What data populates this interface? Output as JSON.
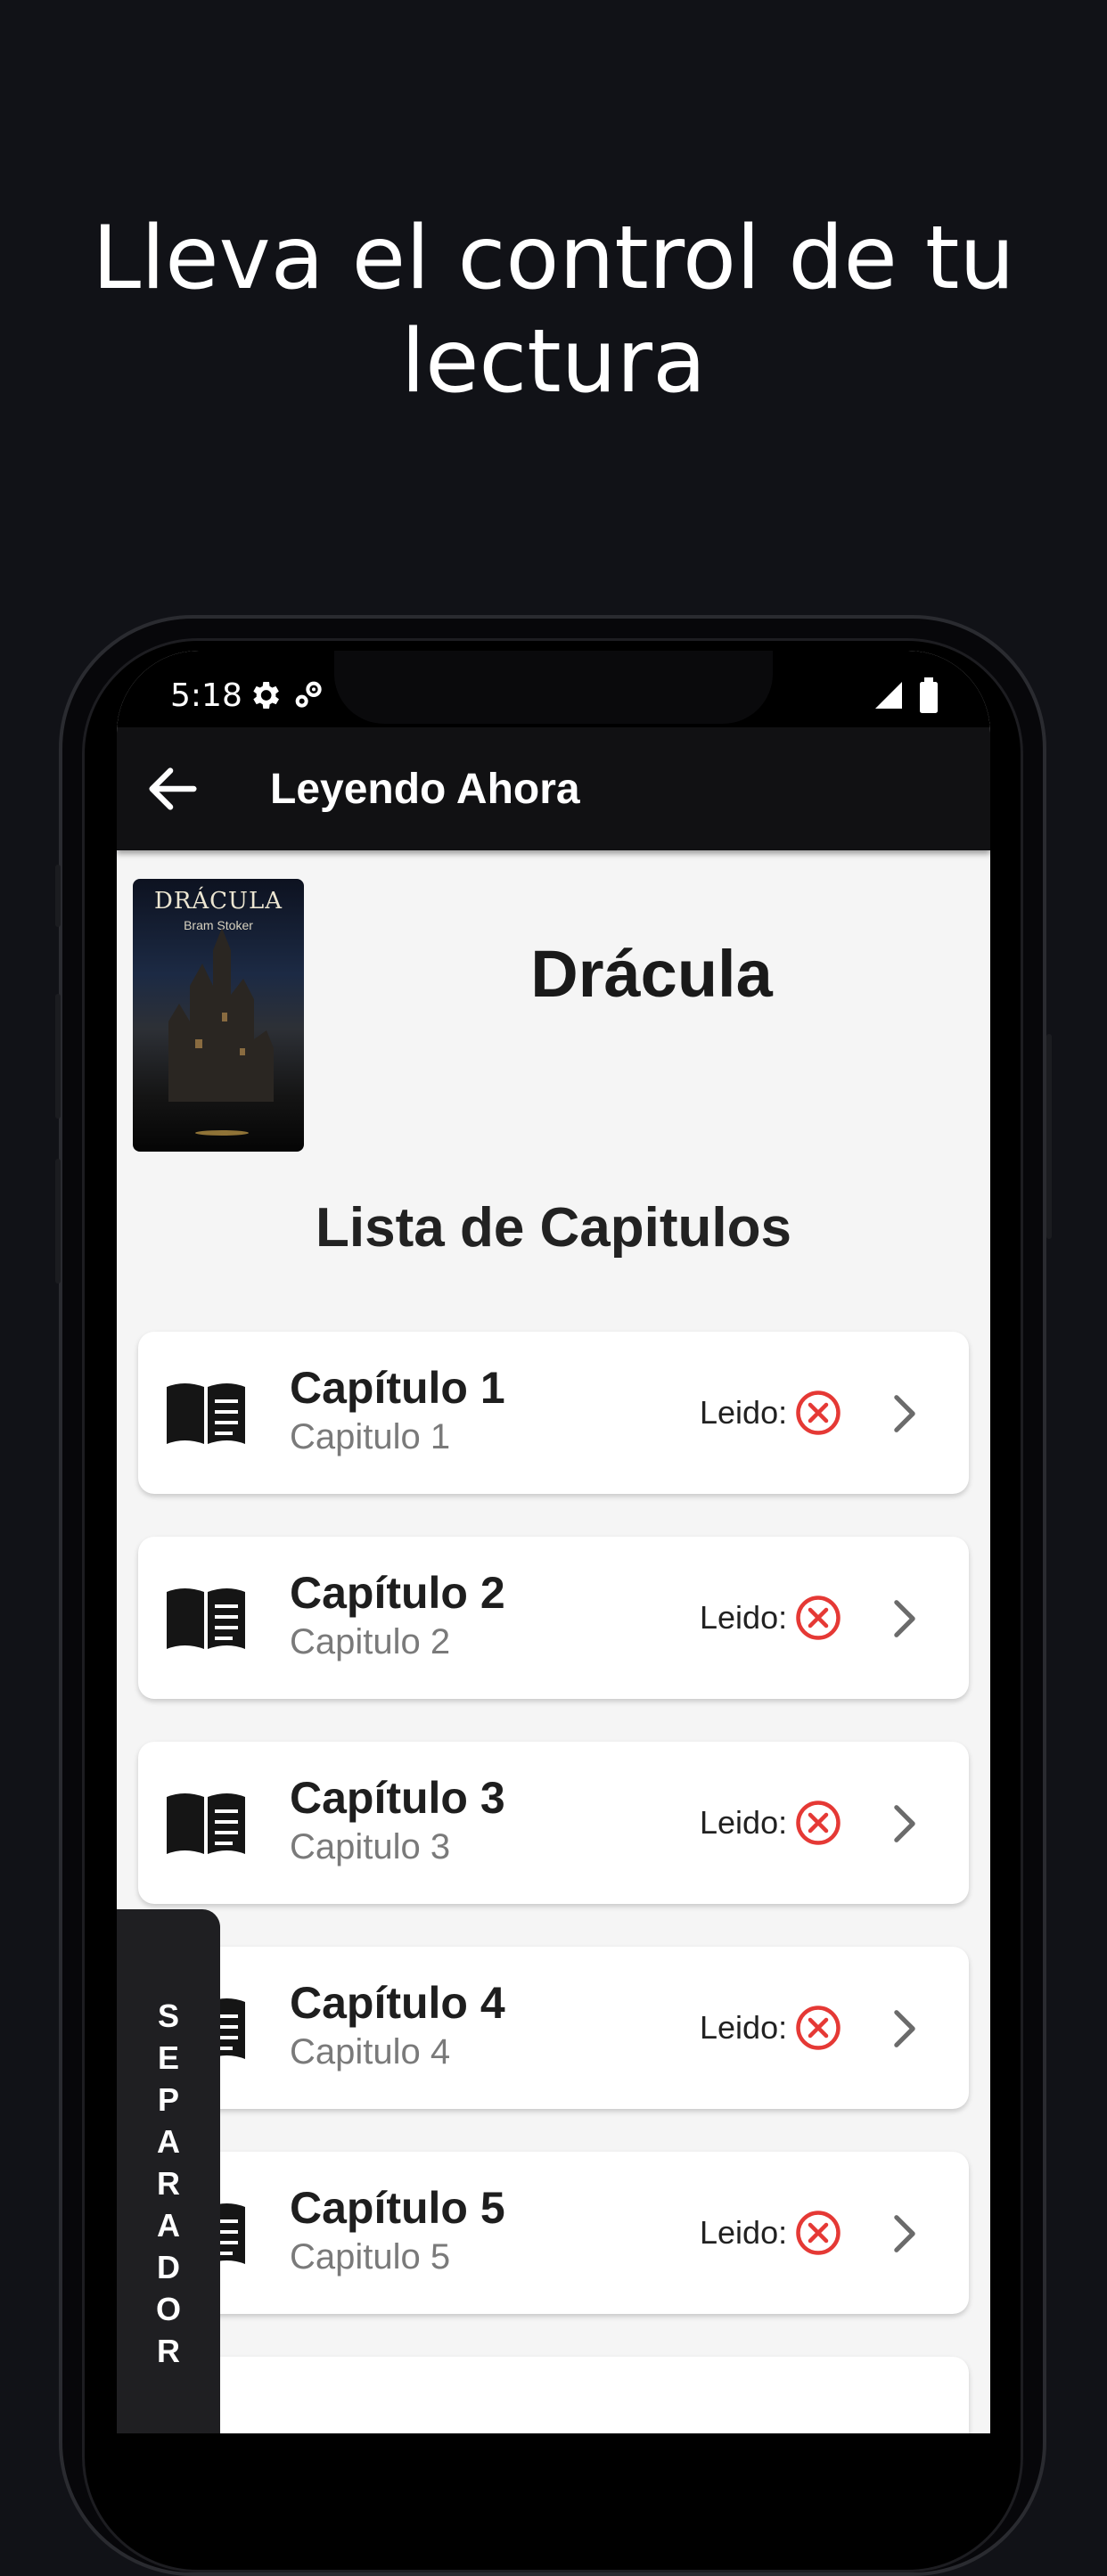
{
  "headline": {
    "line1": "Lleva el control de tu",
    "line2": "lectura"
  },
  "status_bar": {
    "time": "5:18",
    "icons": [
      "gear-icon",
      "settings-cog-icon",
      "signal-icon",
      "battery-icon"
    ]
  },
  "app_bar": {
    "back_icon": "arrow-left-icon",
    "title": "Leyendo Ahora"
  },
  "book": {
    "cover_title": "DRÁCULA",
    "cover_author": "Bram Stoker",
    "title": "Drácula"
  },
  "chapters_section": {
    "title": "Lista de Capitulos",
    "read_label": "Leido:",
    "items": [
      {
        "title": "Capítulo 1",
        "subtitle": "Capitulo 1",
        "read": false
      },
      {
        "title": "Capítulo 2",
        "subtitle": "Capitulo 2",
        "read": false
      },
      {
        "title": "Capítulo 3",
        "subtitle": "Capitulo 3",
        "read": false
      },
      {
        "title": "Capítulo 4",
        "subtitle": "Capitulo 4",
        "read": false
      },
      {
        "title": "Capítulo 5",
        "subtitle": "Capitulo 5",
        "read": false
      }
    ]
  },
  "separator": {
    "label": "SEPARADOR"
  },
  "colors": {
    "background": "#111217",
    "app_bar": "#111113",
    "unread_icon": "#e53935",
    "screen_bg": "#f5f5f5"
  }
}
